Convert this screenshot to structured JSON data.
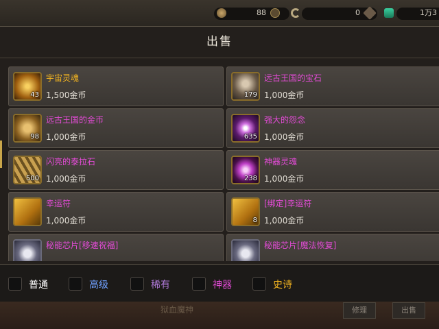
{
  "topbar": {
    "currency1": "88",
    "currency2": "0",
    "currency3": "1万3"
  },
  "panel": {
    "title": "出售"
  },
  "items": [
    {
      "name": "宇宙灵魂",
      "price": "1,500金币",
      "qty": "43",
      "rarity": "legendary",
      "color": "#f4b520"
    },
    {
      "name": "远古王国的宝石",
      "price": "1,000金币",
      "qty": "179",
      "rarity": "epic",
      "color": "#e34bd6"
    },
    {
      "name": "远古王国的金币",
      "price": "1,000金币",
      "qty": "98",
      "rarity": "epic",
      "color": "#e34bd6"
    },
    {
      "name": "强大的怨念",
      "price": "1,000金币",
      "qty": "635",
      "rarity": "epic",
      "color": "#e34bd6"
    },
    {
      "name": "闪亮的泰拉石",
      "price": "1,000金币",
      "qty": "500",
      "rarity": "epic",
      "color": "#e34bd6"
    },
    {
      "name": "神器灵魂",
      "price": "1,000金币",
      "qty": "238",
      "rarity": "epic",
      "color": "#e34bd6"
    },
    {
      "name": "幸运符",
      "price": "1,000金币",
      "qty": "",
      "rarity": "epic",
      "color": "#e34bd6"
    },
    {
      "name": "[绑定]幸运符",
      "price": "1,000金币",
      "qty": "8",
      "rarity": "epic",
      "color": "#e34bd6"
    },
    {
      "name": "秘能芯片[移速祝福]",
      "price": "",
      "qty": "",
      "rarity": "epic",
      "color": "#e34bd6"
    },
    {
      "name": "秘能芯片[魔法恢复]",
      "price": "",
      "qty": "",
      "rarity": "epic",
      "color": "#e34bd6"
    }
  ],
  "filters": [
    {
      "label": "普通",
      "color": "#ffffff"
    },
    {
      "label": "高级",
      "color": "#6fa0ff"
    },
    {
      "label": "稀有",
      "color": "#b07ad8"
    },
    {
      "label": "神器",
      "color": "#e34bd6"
    },
    {
      "label": "史诗",
      "color": "#f4b520"
    }
  ],
  "bottom": {
    "text": "狱血魔神",
    "repair": "修理",
    "sell": "出售"
  }
}
